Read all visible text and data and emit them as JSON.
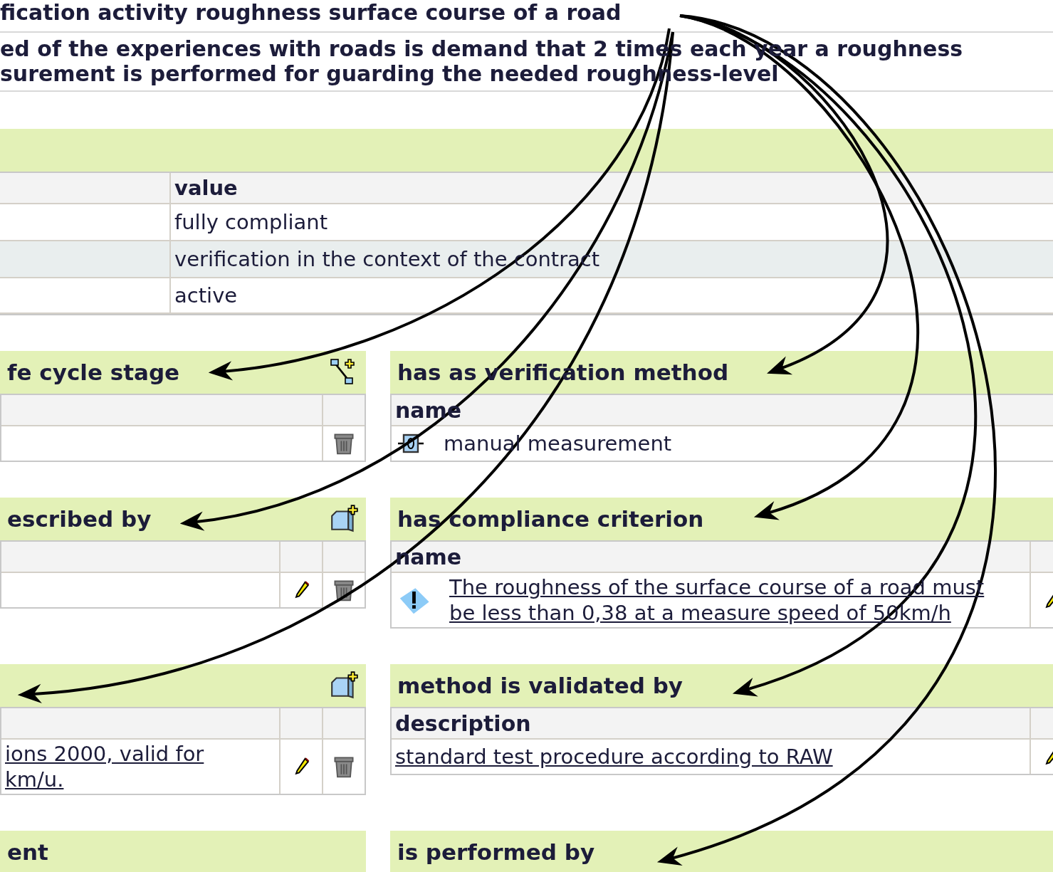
{
  "title": "fication activity roughness surface course of a road",
  "description": [
    "ed of the experiences with roads is demand that 2 times each year a roughness",
    "surement is performed for guarding the needed roughness-level"
  ],
  "properties": {
    "heading": "value",
    "rows": [
      {
        "value": "fully compliant",
        "highlighted": false
      },
      {
        "value": "verification in the context of the contract",
        "highlighted": true
      },
      {
        "value": "active",
        "highlighted": false
      }
    ]
  },
  "sections": [
    {
      "left": {
        "title": "fe cycle stage",
        "kind": "relation",
        "rows": [
          {
            "deletable": true
          }
        ]
      },
      "right": {
        "title": "has as verification method",
        "heading": "name",
        "rows": [
          {
            "kind": "method",
            "lines": [
              "manual measurement"
            ],
            "link": false
          }
        ]
      }
    },
    {
      "left": {
        "title": "escribed by",
        "kind": "document",
        "rows": [
          {
            "editable": true,
            "deletable": true
          }
        ]
      },
      "right": {
        "title": "has compliance criterion",
        "heading": "name",
        "rows": [
          {
            "kind": "criterion",
            "lines": [
              "The roughness of the surface course of a road must",
              "be less than 0,38 at a measure speed of 50km/h"
            ],
            "link": true,
            "editable": true
          }
        ]
      }
    },
    {
      "left": {
        "kind": "document",
        "rows": [
          {
            "lines": [
              "ions 2000, valid for",
              "km/u."
            ],
            "link": true,
            "editable": true,
            "deletable": true
          }
        ]
      },
      "right": {
        "title": "method is validated by",
        "heading": "description",
        "rows": [
          {
            "lines": [
              "standard test procedure according to RAW"
            ],
            "link": true,
            "editable": true
          }
        ]
      }
    },
    {
      "left": {
        "title": "ent"
      },
      "right": {
        "title": "is performed by"
      }
    }
  ]
}
